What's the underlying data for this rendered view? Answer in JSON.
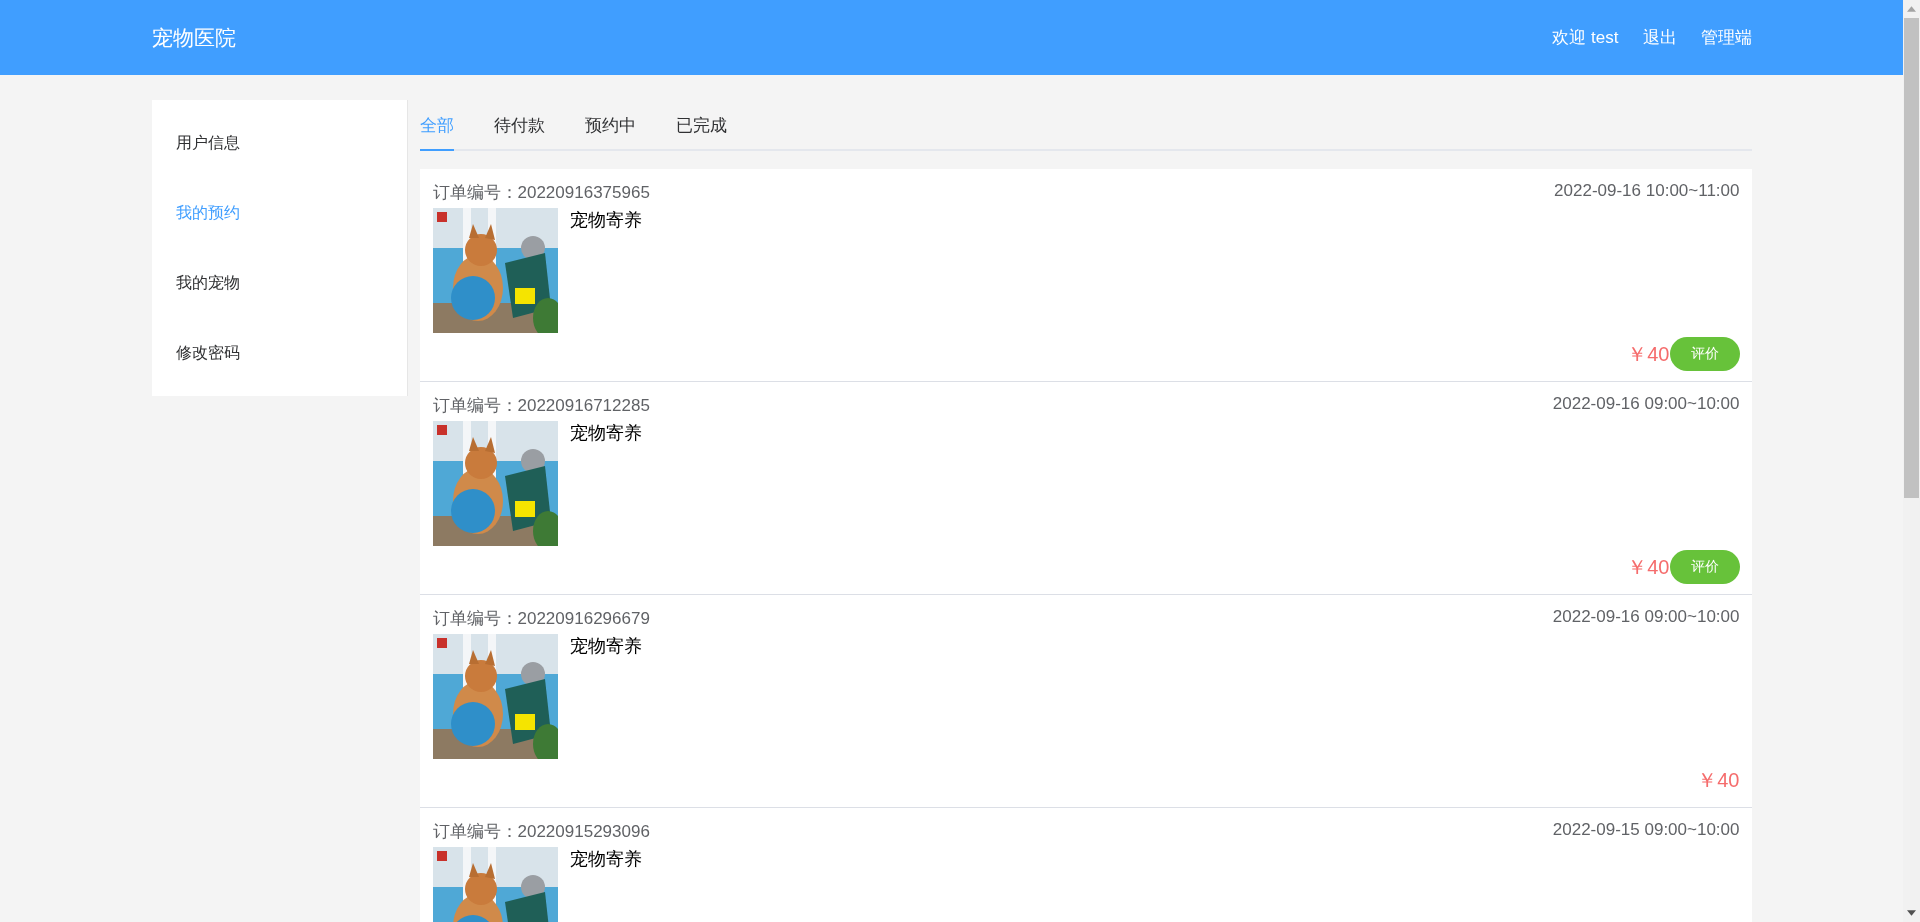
{
  "header": {
    "title": "宠物医院",
    "links": [
      "欢迎 test",
      "退出",
      "管理端"
    ]
  },
  "sidebar": {
    "items": [
      {
        "label": "用户信息",
        "selected": false
      },
      {
        "label": "我的预约",
        "selected": true
      },
      {
        "label": "我的宠物",
        "selected": false
      },
      {
        "label": "修改密码",
        "selected": false
      }
    ]
  },
  "tabs": [
    {
      "label": "全部",
      "selected": true
    },
    {
      "label": "待付款",
      "selected": false
    },
    {
      "label": "预约中",
      "selected": false
    },
    {
      "label": "已完成",
      "selected": false
    }
  ],
  "orders": [
    {
      "order_no": "订单编号：20220916375965",
      "time": "2022-09-16 10:00~11:00",
      "service": "宠物寄养",
      "price": "￥40",
      "button": "评价"
    },
    {
      "order_no": "订单编号：20220916712285",
      "time": "2022-09-16 09:00~10:00",
      "service": "宠物寄养",
      "price": "￥40",
      "button": "评价"
    },
    {
      "order_no": "订单编号：20220916296679",
      "time": "2022-09-16 09:00~10:00",
      "service": "宠物寄养",
      "price": "￥40"
    },
    {
      "order_no": "订单编号：20220915293096",
      "time": "2022-09-15 09:00~10:00",
      "service": "宠物寄养"
    }
  ]
}
